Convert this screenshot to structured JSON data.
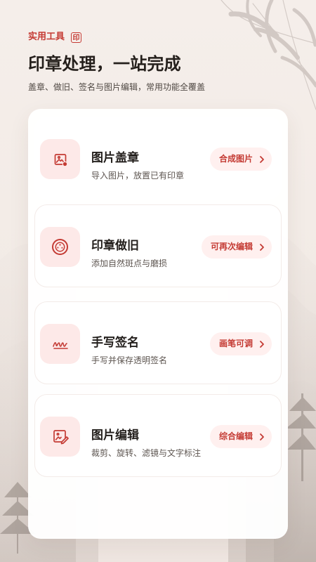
{
  "header": {
    "tag_label": "实用工具",
    "seal_glyph": "印",
    "title": "印章处理，一站完成",
    "subtitle": "盖章、做旧、签名与图片编辑，常用功能全覆盖"
  },
  "tools": [
    {
      "title": "图片盖章",
      "description": "导入图片，放置已有印章",
      "action_label": "合成图片",
      "icon": "image-stamp-icon"
    },
    {
      "title": "印章做旧",
      "description": "添加自然斑点与磨损",
      "action_label": "可再次编辑",
      "icon": "aged-seal-icon"
    },
    {
      "title": "手写签名",
      "description": "手写并保存透明签名",
      "action_label": "画笔可调",
      "icon": "signature-icon"
    },
    {
      "title": "图片编辑",
      "description": "裁剪、旋转、滤镜与文字标注",
      "action_label": "综合编辑",
      "icon": "image-edit-icon"
    }
  ],
  "colors": {
    "accent": "#c53a33",
    "icon_background": "#fde9e8",
    "action_background": "#fff0ef",
    "page_background": "#f5eeea"
  }
}
